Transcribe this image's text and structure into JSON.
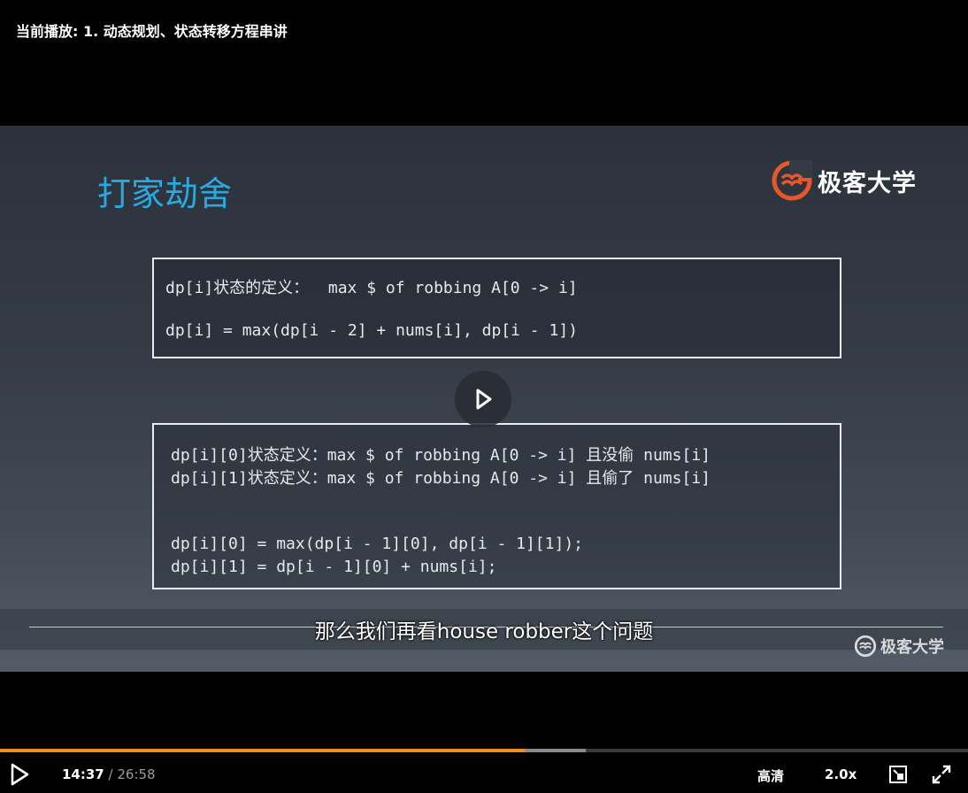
{
  "header": {
    "now_playing": "当前播放: 1. 动态规划、状态转移方程串讲"
  },
  "slide": {
    "title": "打家劫舍",
    "brand": "极客大学",
    "box1": [
      "dp[i]状态的定义：  max $ of robbing A[0 -> i]",
      "dp[i] = max(dp[i - 2] + nums[i], dp[i - 1])"
    ],
    "box2": [
      "dp[i][0]状态定义：max $ of robbing A[0 -> i] 且没偷 nums[i]",
      "dp[i][1]状态定义：max $ of robbing A[0 -> i] 且偷了 nums[i]",
      "dp[i][0] = max(dp[i - 1][0], dp[i - 1][1]);",
      "dp[i][1] = dp[i - 1][0] + nums[i];"
    ]
  },
  "subtitle": "那么我们再看house robber这个问题",
  "watermark": "极客大学",
  "controls": {
    "current_time": "14:37",
    "separator": "/",
    "duration": "26:58",
    "progress_fraction": 0.542,
    "buffered_fraction": 0.605,
    "quality": "高清",
    "speed": "2.0x"
  },
  "colors": {
    "title": "#29a9e1",
    "logo_orange": "#e8562a",
    "progress": "#f08c1d"
  },
  "icons": {
    "center_play": "play-icon",
    "control_play": "play-icon",
    "pip": "picture-in-picture-icon",
    "fullscreen": "fullscreen-icon"
  }
}
